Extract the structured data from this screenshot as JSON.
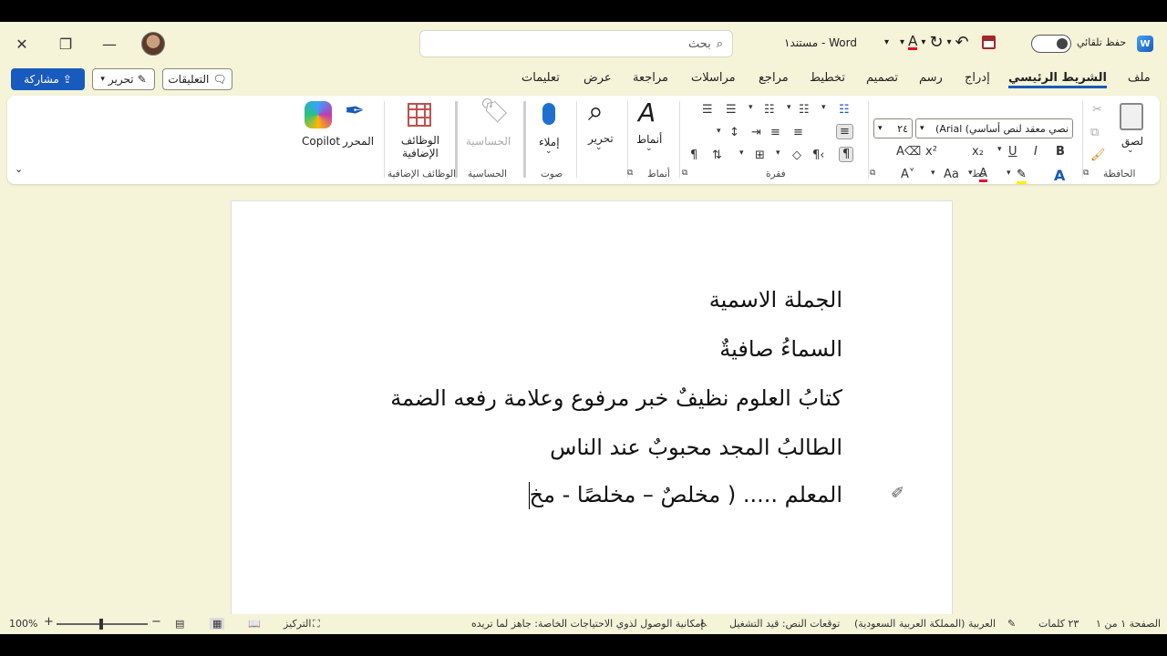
{
  "titlebar": {
    "search_placeholder": "بحث",
    "doc_title": "مستند١ - Word",
    "autosave": "حفظ تلقائي",
    "logo": "W",
    "icons": {
      "close": "close-icon",
      "restore": "restore-icon",
      "minimize": "minimize-icon",
      "search": "search-icon",
      "undo": "undo-icon",
      "redo": "redo-icon",
      "save": "save-icon",
      "font_color": "font-color-icon"
    }
  },
  "menus": {
    "file": "ملف",
    "home": "الشريط الرئيسي",
    "insert": "إدراج",
    "draw": "رسم",
    "design": "تصميم",
    "layout": "تخطيط",
    "references": "مراجع",
    "mailings": "مراسلات",
    "review": "مراجعة",
    "view": "عرض",
    "help": "تعليمات"
  },
  "actions": {
    "share": "مشاركة",
    "edit": "تحرير",
    "comments": "التعليقات"
  },
  "ribbon": {
    "paste": "لصق",
    "clipboard": "الحافظة",
    "font_name": "نصي معقد لنص أساسي) Arial)",
    "font_size": "٢٤",
    "font_group": "خط",
    "paragraph_group": "فقرة",
    "styles": "أنماط",
    "styles_group": "أنماط",
    "editing": "تحرير",
    "dictate": "إملاء",
    "voice_group": "صوت",
    "sensitivity": "الحساسية",
    "sensitivity_group": "الحساسية",
    "addins": "الوظائف الإضافية",
    "addins_group": "الوظائف الإضافية",
    "editor": "المحرر",
    "copilot": "Copilot",
    "bold": "B",
    "italic": "I",
    "underline": "U",
    "case": "Aa"
  },
  "document": {
    "lines": [
      "الجملة الاسمية",
      "السماءُ صافيةٌ",
      "كتابُ العلوم نظيفٌ خبر مرفوع وعلامة رفعه الضمة",
      "الطالبُ المجد محبوبٌ عند الناس",
      "المعلم ..... ( مخلصٌ – مخلصًا - مخ"
    ]
  },
  "statusbar": {
    "page": "الصفحة ١ من ١",
    "words": "٢٣ كلمات",
    "language": "العربية (المملكة العربية السعودية)",
    "text_predictions": "توقعات النص: قيد التشغيل",
    "accessibility": "إمكانية الوصول لذوي الاحتياجات الخاصة: جاهز لما تريده",
    "focus": "التركيز",
    "zoom": "100%"
  },
  "colors": {
    "accent": "#185abd",
    "background": "#f5f3d8",
    "font_red": "#e81123",
    "highlight": "#fff100"
  }
}
